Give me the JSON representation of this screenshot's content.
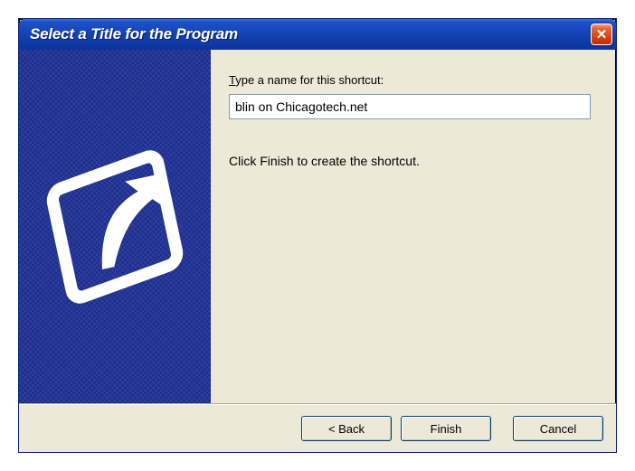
{
  "window": {
    "title": "Select a Title for the Program"
  },
  "content": {
    "label_prefix": "T",
    "label_rest": "ype a name for this shortcut:",
    "input_value": "blin on Chicagotech.net",
    "instruction": "Click Finish to create the shortcut."
  },
  "buttons": {
    "back": "< Back",
    "finish": "Finish",
    "cancel": "Cancel"
  },
  "close_glyph": "✕"
}
